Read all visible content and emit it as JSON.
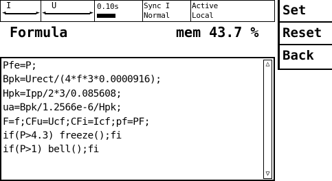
{
  "status": {
    "current_label": "I",
    "voltage_label": "U",
    "time_value": "0.10s",
    "time_fill": 0.45,
    "sync_line1": "Sync I",
    "sync_line2": "Normal",
    "state_line1": "Active",
    "state_line2": "Local"
  },
  "menu": [
    {
      "label": "Set"
    },
    {
      "label": "Reset"
    },
    {
      "label": "Back"
    }
  ],
  "header": {
    "title": "Formula",
    "mem": "mem 43.7 %"
  },
  "editor": {
    "lines": [
      "Pfe=P;",
      "Bpk=Urect/(4*f*3*0.0000916);",
      "Hpk=Ipp/2*3/0.085608;",
      "ua=Bpk/1.2566e-6/Hpk;",
      "F=f;CFu=Ucf;CFi=Icf;pf=PF;",
      "if(P>4.3) freeze();fi",
      "if(P>1) bell();fi"
    ],
    "scroll_up_icon": "triangle-up",
    "scroll_down_icon": "triangle-down"
  }
}
